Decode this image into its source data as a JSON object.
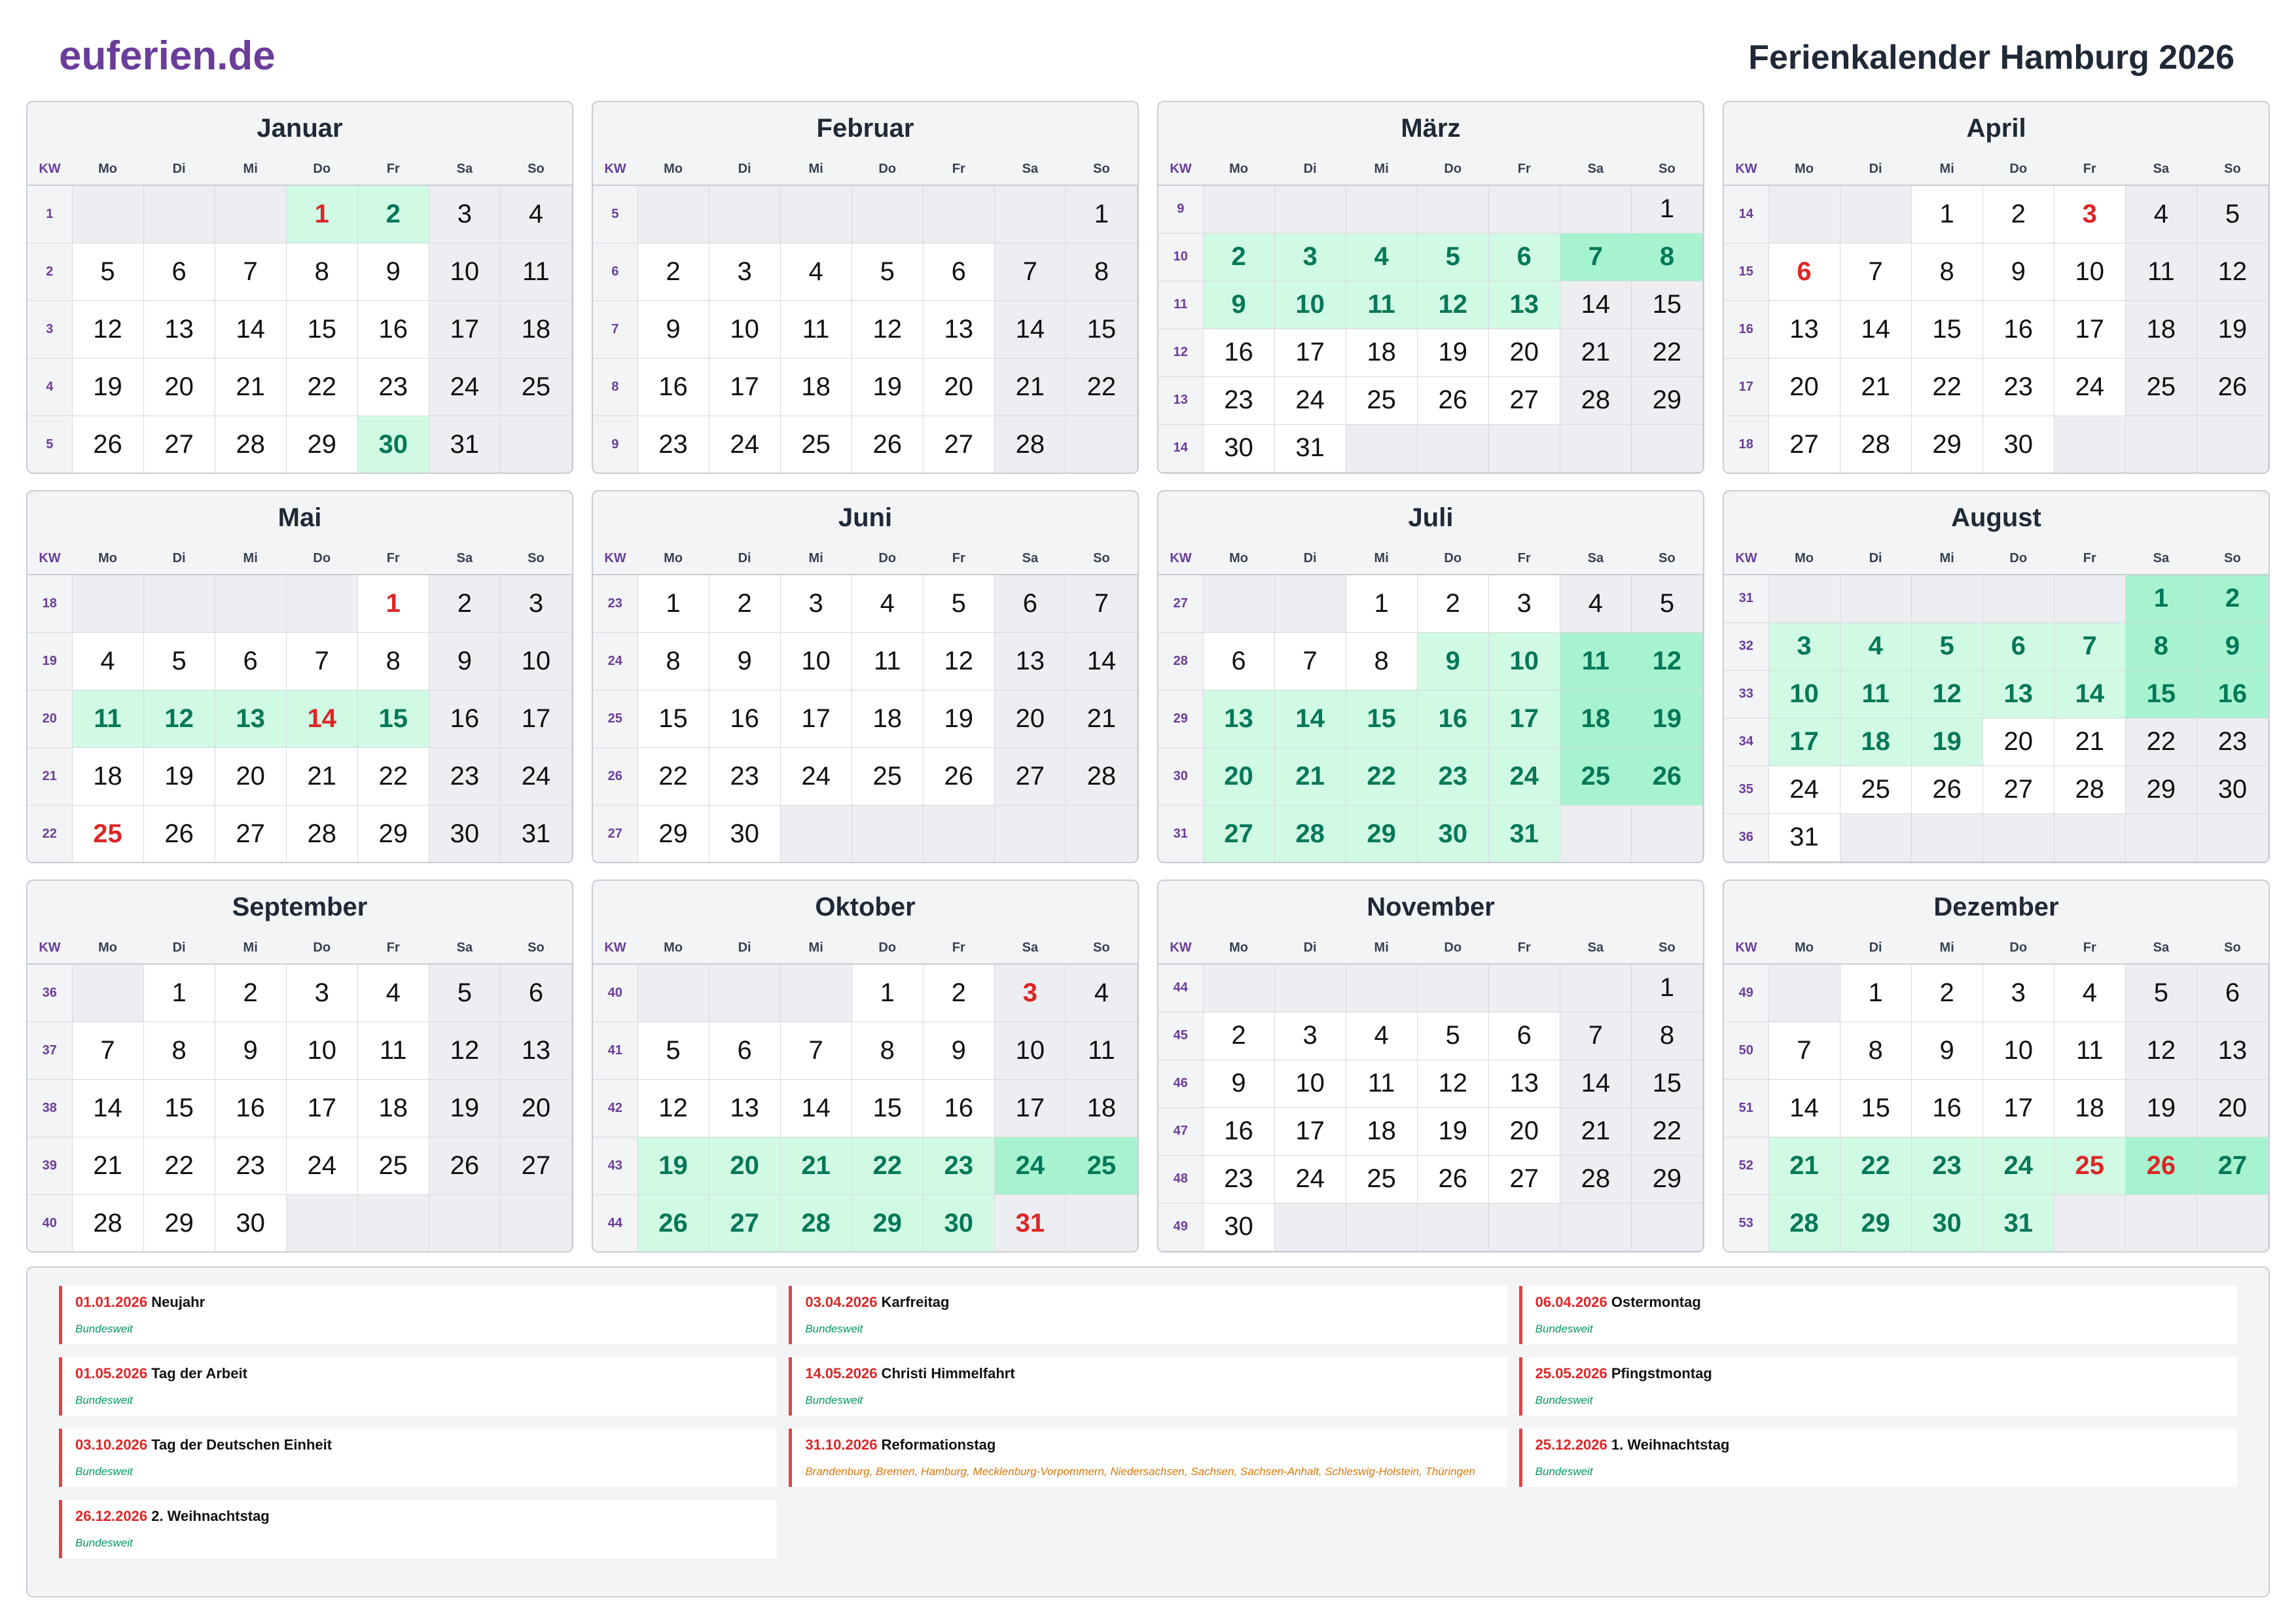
{
  "header": {
    "brand": "euferien.de",
    "title": "Ferienkalender Hamburg 2026"
  },
  "weekday_labels": [
    "KW",
    "Mo",
    "Di",
    "Mi",
    "Do",
    "Fr",
    "Sa",
    "So"
  ],
  "colors": {
    "brand": "#6a3d9a",
    "holiday_green": "#d1fae5",
    "holiday_text": "#047857",
    "public_holiday_red": "#dc2626"
  },
  "months": [
    {
      "name": "Januar",
      "offset": 3,
      "days": 31,
      "kw": [
        "1",
        "2",
        "3",
        "4",
        "5"
      ],
      "holidays": [
        1,
        2,
        30
      ],
      "public_holidays": [
        1
      ]
    },
    {
      "name": "Februar",
      "offset": 6,
      "days": 28,
      "kw": [
        "5",
        "6",
        "7",
        "8",
        "9"
      ],
      "holidays": [],
      "public_holidays": []
    },
    {
      "name": "März",
      "offset": 6,
      "days": 31,
      "kw": [
        "9",
        "10",
        "11",
        "12",
        "13",
        "14"
      ],
      "holidays": [
        2,
        3,
        4,
        5,
        6,
        7,
        8,
        9,
        10,
        11,
        12,
        13
      ],
      "public_holidays": []
    },
    {
      "name": "April",
      "offset": 2,
      "days": 30,
      "kw": [
        "14",
        "15",
        "16",
        "17",
        "18"
      ],
      "holidays": [],
      "public_holidays": [
        3,
        6
      ]
    },
    {
      "name": "Mai",
      "offset": 4,
      "days": 31,
      "kw": [
        "18",
        "19",
        "20",
        "21",
        "22"
      ],
      "holidays": [
        11,
        12,
        13,
        14,
        15
      ],
      "public_holidays": [
        1,
        14,
        25
      ]
    },
    {
      "name": "Juni",
      "offset": 0,
      "days": 30,
      "kw": [
        "23",
        "24",
        "25",
        "26",
        "27"
      ],
      "holidays": [],
      "public_holidays": []
    },
    {
      "name": "Juli",
      "offset": 2,
      "days": 31,
      "kw": [
        "27",
        "28",
        "29",
        "30",
        "31"
      ],
      "holidays": [
        9,
        10,
        11,
        12,
        13,
        14,
        15,
        16,
        17,
        18,
        19,
        20,
        21,
        22,
        23,
        24,
        25,
        26,
        27,
        28,
        29,
        30,
        31
      ],
      "public_holidays": []
    },
    {
      "name": "August",
      "offset": 5,
      "days": 31,
      "kw": [
        "31",
        "32",
        "33",
        "34",
        "35",
        "36"
      ],
      "holidays": [
        1,
        2,
        3,
        4,
        5,
        6,
        7,
        8,
        9,
        10,
        11,
        12,
        13,
        14,
        15,
        16,
        17,
        18,
        19
      ],
      "public_holidays": []
    },
    {
      "name": "September",
      "offset": 1,
      "days": 30,
      "kw": [
        "36",
        "37",
        "38",
        "39",
        "40"
      ],
      "holidays": [],
      "public_holidays": []
    },
    {
      "name": "Oktober",
      "offset": 3,
      "days": 31,
      "kw": [
        "40",
        "41",
        "42",
        "43",
        "44"
      ],
      "holidays": [
        19,
        20,
        21,
        22,
        23,
        24,
        25,
        26,
        27,
        28,
        29,
        30
      ],
      "public_holidays": [
        3,
        31
      ]
    },
    {
      "name": "November",
      "offset": 6,
      "days": 30,
      "kw": [
        "44",
        "45",
        "46",
        "47",
        "48",
        "49"
      ],
      "holidays": [],
      "public_holidays": []
    },
    {
      "name": "Dezember",
      "offset": 1,
      "days": 31,
      "kw": [
        "49",
        "50",
        "51",
        "52",
        "53"
      ],
      "holidays": [
        21,
        22,
        23,
        24,
        25,
        26,
        27,
        28,
        29,
        30,
        31
      ],
      "public_holidays": [
        25,
        26
      ]
    }
  ],
  "public_holidays_list": [
    {
      "date": "01.01.2026",
      "name": "Neujahr",
      "region": "Bundesweit",
      "partial": false
    },
    {
      "date": "03.04.2026",
      "name": "Karfreitag",
      "region": "Bundesweit",
      "partial": false
    },
    {
      "date": "06.04.2026",
      "name": "Ostermontag",
      "region": "Bundesweit",
      "partial": false
    },
    {
      "date": "01.05.2026",
      "name": "Tag der Arbeit",
      "region": "Bundesweit",
      "partial": false
    },
    {
      "date": "14.05.2026",
      "name": "Christi Himmelfahrt",
      "region": "Bundesweit",
      "partial": false
    },
    {
      "date": "25.05.2026",
      "name": "Pfingstmontag",
      "region": "Bundesweit",
      "partial": false
    },
    {
      "date": "03.10.2026",
      "name": "Tag der Deutschen Einheit",
      "region": "Bundesweit",
      "partial": false
    },
    {
      "date": "31.10.2026",
      "name": "Reformationstag",
      "region": "Brandenburg, Bremen, Hamburg, Mecklenburg-Vorpommern, Niedersachsen, Sachsen, Sachsen-Anhalt, Schleswig-Holstein, Thüringen",
      "partial": true
    },
    {
      "date": "25.12.2026",
      "name": "1. Weihnachtstag",
      "region": "Bundesweit",
      "partial": false
    },
    {
      "date": "26.12.2026",
      "name": "2. Weihnachtstag",
      "region": "Bundesweit",
      "partial": false
    }
  ]
}
